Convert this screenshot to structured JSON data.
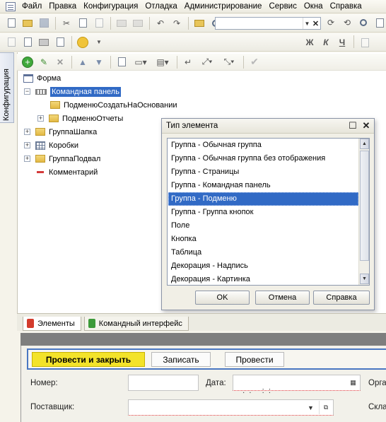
{
  "menu": {
    "items": [
      "Файл",
      "Правка",
      "Конфигурация",
      "Отладка",
      "Администрирование",
      "Сервис",
      "Окна",
      "Справка"
    ]
  },
  "side_panel": {
    "label": "Конфигурация"
  },
  "tree": {
    "items": [
      {
        "label": "Форма"
      },
      {
        "label": "Командная панель"
      },
      {
        "label": "ПодменюСоздатьНаОсновании"
      },
      {
        "label": "ПодменюОтчеты"
      },
      {
        "label": "ГруппаШапка"
      },
      {
        "label": "Коробки"
      },
      {
        "label": "ГруппаПодвал"
      },
      {
        "label": "Комментарий"
      }
    ]
  },
  "dialog": {
    "title": "Тип элемента",
    "items": [
      "Группа - Обычная группа",
      "Группа - Обычная группа без отображения",
      "Группа - Страницы",
      "Группа - Командная панель",
      "Группа - Подменю",
      "Группа - Группа кнопок",
      "Поле",
      "Кнопка",
      "Таблица",
      "Декорация - Надпись",
      "Декорация - Картинка"
    ],
    "selected_index": 4,
    "ok_label": "OK",
    "cancel_label": "Отмена",
    "help_label": "Справка"
  },
  "editor_tabs": {
    "elements": "Элементы",
    "command_interface": "Командный интерфейс"
  },
  "preview": {
    "buttons": [
      "Провести и закрыть",
      "Записать",
      "Провести"
    ],
    "number_label": "Номер:",
    "date_label": "Дата:",
    "date_mask": " .  .     :  :  ",
    "org_label_partial": "Орга",
    "supplier_label": "Поставщик:",
    "warehouse_label_partial": "Скла"
  },
  "colors": {
    "selection": "#316ac5",
    "primary_button": "#f3e32a",
    "preview_focus_border": "#4a77c2"
  }
}
